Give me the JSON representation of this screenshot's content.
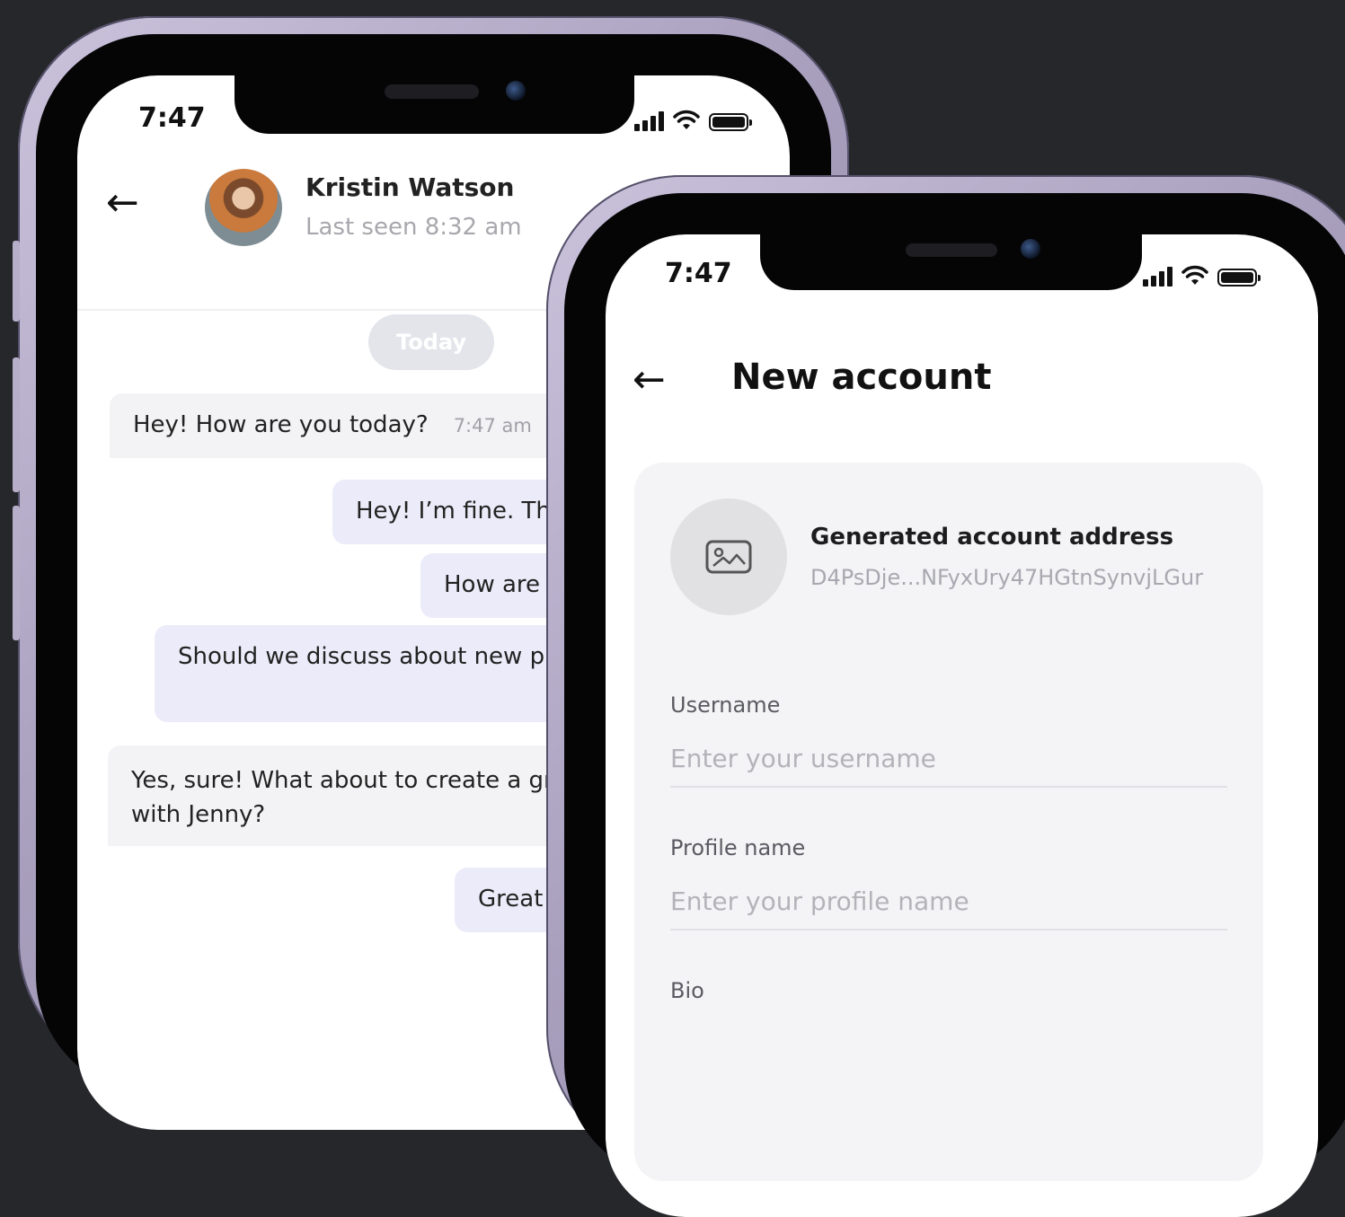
{
  "chat_screen": {
    "status_time": "7:47",
    "contact": {
      "name": "Kristin Watson",
      "last_seen": "Last seen 8:32 am"
    },
    "date_divider": "Today",
    "messages": [
      {
        "text": "Hey! How are you today?",
        "time": "7:47 am",
        "direction": "incoming"
      },
      {
        "text": "Hey! I’m fine. Th",
        "direction": "outgoing"
      },
      {
        "text": "How are",
        "direction": "outgoing"
      },
      {
        "text": "Should we discuss about new p",
        "direction": "outgoing"
      },
      {
        "text": "Yes, sure! What about to create a gr",
        "text2": "with Jenny?",
        "direction": "incoming"
      },
      {
        "text": "Great",
        "direction": "outgoing"
      }
    ]
  },
  "account_screen": {
    "status_time": "7:47",
    "title": "New account",
    "address_card": {
      "icon": "image-icon",
      "title": "Generated account address",
      "address": "D4PsDje...NFyxUry47HGtnSynvjLGur"
    },
    "fields": [
      {
        "label": "Username",
        "placeholder": "Enter your username",
        "value": ""
      },
      {
        "label": "Profile name",
        "placeholder": "Enter your profile name",
        "value": ""
      },
      {
        "label": "Bio"
      }
    ]
  },
  "colors": {
    "background": "#26272b",
    "frame": "#b0a8c5",
    "incoming_bubble": "#f3f3f5",
    "outgoing_bubble": "#ecebf9",
    "card": "#f4f4f6"
  }
}
